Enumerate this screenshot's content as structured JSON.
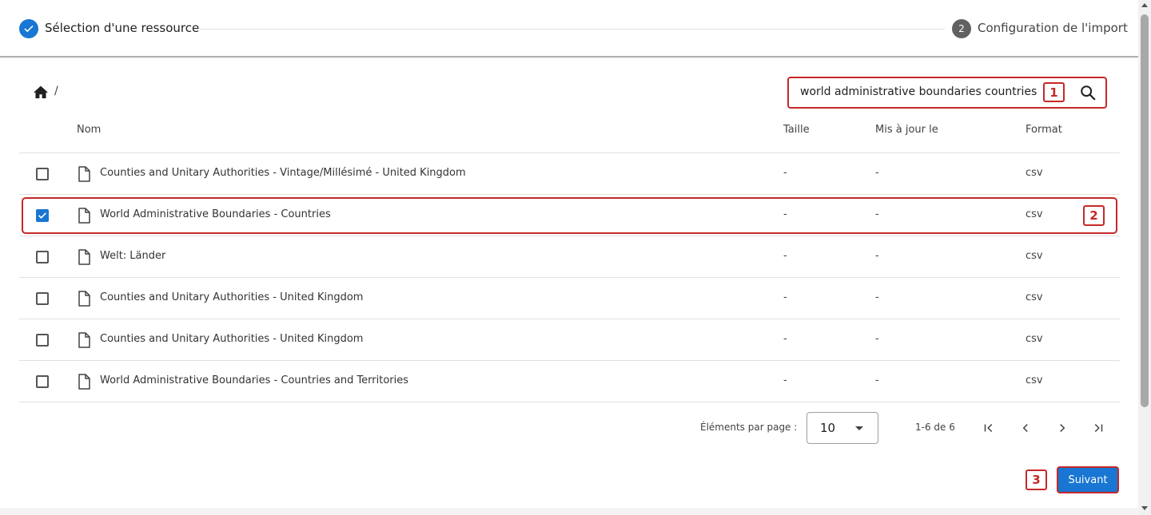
{
  "stepper": {
    "step1": {
      "label": "Sélection d'une ressource",
      "done": true
    },
    "step2": {
      "number": "2",
      "label": "Configuration de l'import"
    }
  },
  "breadcrumb": {
    "separator": "/"
  },
  "search": {
    "value": "world administrative boundaries countries"
  },
  "markers": {
    "m1": "1",
    "m2": "2",
    "m3": "3"
  },
  "table": {
    "headers": {
      "name": "Nom",
      "size": "Taille",
      "updated": "Mis à jour le",
      "format": "Format"
    },
    "rows": [
      {
        "name": "Counties and Unitary Authorities - Vintage/Millésimé - United Kingdom",
        "size": "-",
        "updated": "-",
        "format": "csv",
        "checked": false
      },
      {
        "name": "World Administrative Boundaries - Countries",
        "size": "-",
        "updated": "-",
        "format": "csv",
        "checked": true
      },
      {
        "name": "Welt: Länder",
        "size": "-",
        "updated": "-",
        "format": "csv",
        "checked": false
      },
      {
        "name": "Counties and Unitary Authorities - United Kingdom",
        "size": "-",
        "updated": "-",
        "format": "csv",
        "checked": false
      },
      {
        "name": "Counties and Unitary Authorities - United Kingdom",
        "size": "-",
        "updated": "-",
        "format": "csv",
        "checked": false
      },
      {
        "name": "World Administrative Boundaries - Countries and Territories",
        "size": "-",
        "updated": "-",
        "format": "csv",
        "checked": false
      }
    ]
  },
  "paginator": {
    "label": "Éléments par page :",
    "page_size": "10",
    "range": "1-6 de 6"
  },
  "actions": {
    "next_label": "Suivant"
  },
  "colors": {
    "primary": "#1976d2",
    "highlight": "#c62828"
  }
}
